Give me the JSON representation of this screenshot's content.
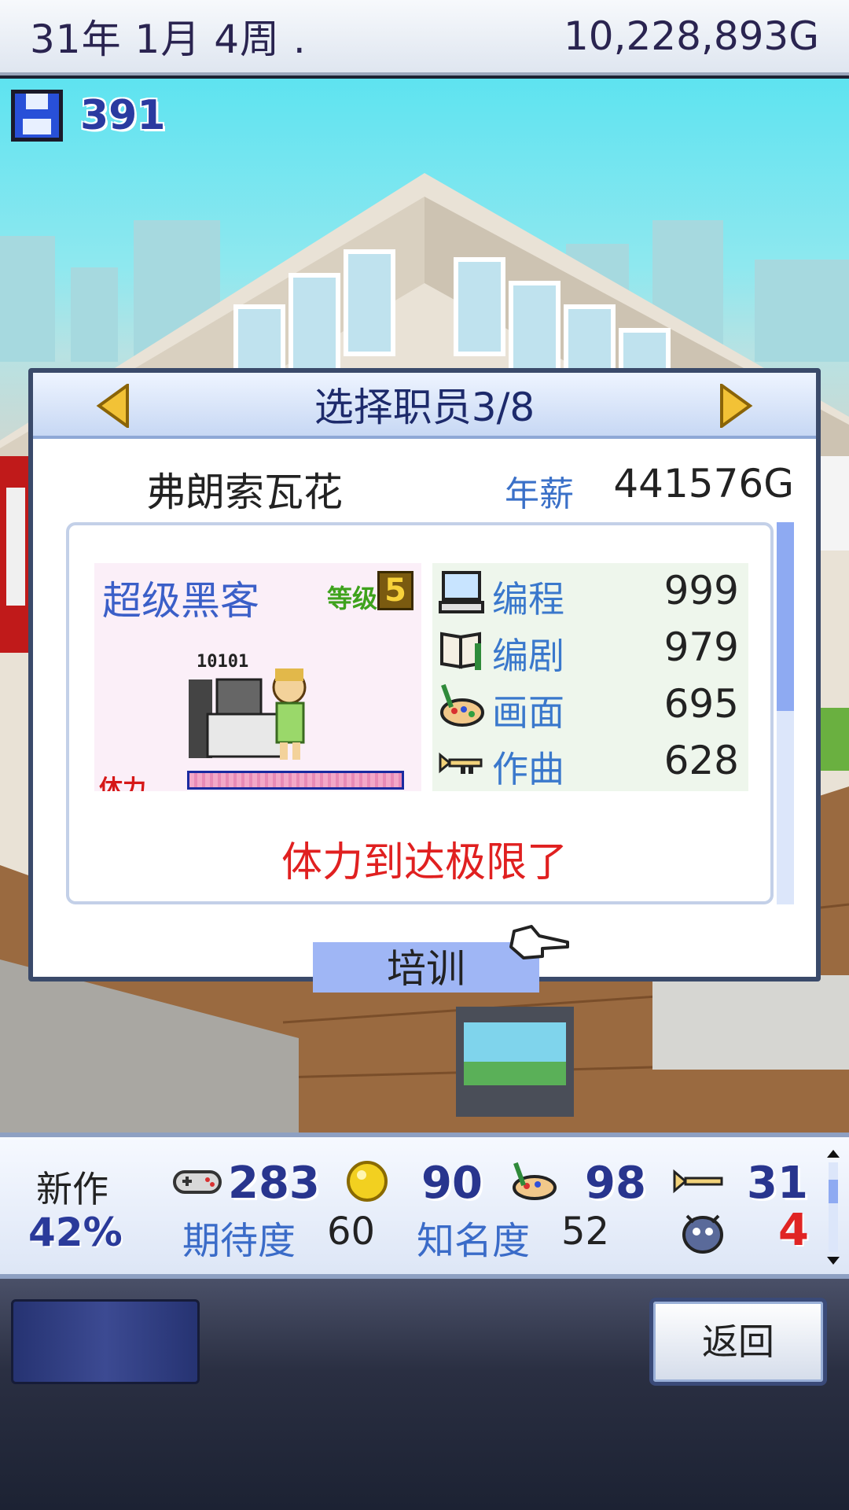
{
  "topbar": {
    "date": "31年 1月 4周 .",
    "money": "10,228,893G"
  },
  "save": {
    "count": "391",
    "icon": "floppy-disk-icon"
  },
  "dialog": {
    "title": "选择职员3/8",
    "employee_name": "弗朗索瓦花",
    "salary_label": "年薪",
    "salary_value": "441576G",
    "job_title": "超级黑客",
    "level_label": "等级",
    "level_value": "5",
    "sprite_caption": "10101",
    "stamina_label": "体力",
    "stamina_fill": 1.0,
    "skills": [
      {
        "label": "编程",
        "value": "999",
        "icon": "computer-icon"
      },
      {
        "label": "编剧",
        "value": "979",
        "icon": "book-icon"
      },
      {
        "label": "画面",
        "value": "695",
        "icon": "palette-icon"
      },
      {
        "label": "作曲",
        "value": "628",
        "icon": "trumpet-icon"
      }
    ],
    "message": "体力到达极限了",
    "train_button": "培训"
  },
  "status": {
    "new_label": "新作",
    "progress": "42%",
    "fun": "283",
    "creativity": "90",
    "graphics": "98",
    "sound": "31",
    "expectation_label": "期待度",
    "expectation_value": "60",
    "fame_label": "知名度",
    "fame_value": "52",
    "bugs": "4"
  },
  "bottom": {
    "back_button": "返回"
  },
  "colors": {
    "accent": "#3a78cc",
    "warning": "#e02020",
    "dialog_border": "#3a4a6a"
  }
}
